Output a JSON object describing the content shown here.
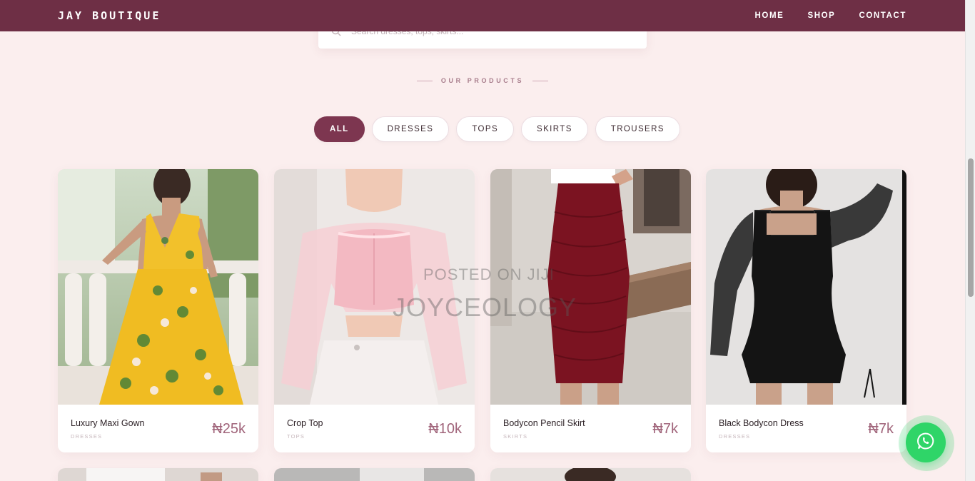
{
  "brand": "JAY BOUTIQUE",
  "nav": [
    "HOME",
    "SHOP",
    "CONTACT"
  ],
  "search": {
    "placeholder": "Search dresses, tops, skirts..."
  },
  "section_title": "OUR PRODUCTS",
  "filters": [
    "ALL",
    "DRESSES",
    "TOPS",
    "SKIRTS",
    "TROUSERS"
  ],
  "active_filter": "ALL",
  "products": [
    {
      "name": "Luxury Maxi Gown",
      "category": "DRESSES",
      "price": "₦25k"
    },
    {
      "name": "Crop Top",
      "category": "TOPS",
      "price": "₦10k"
    },
    {
      "name": "Bodycon Pencil Skirt",
      "category": "SKIRTS",
      "price": "₦7k"
    },
    {
      "name": "Black Bodycon Dress",
      "category": "DRESSES",
      "price": "₦7k"
    }
  ],
  "watermark": {
    "line1": "POSTED ON JIJI",
    "line2": "JOYCEOLOGY"
  },
  "colors": {
    "navbar": "#6e2f45",
    "background": "#fbeeee",
    "accent": "#7d3650",
    "price": "#a0647a",
    "whatsapp": "#2fd568"
  },
  "icons": {
    "search": "search-icon",
    "whatsapp": "whatsapp-icon"
  }
}
